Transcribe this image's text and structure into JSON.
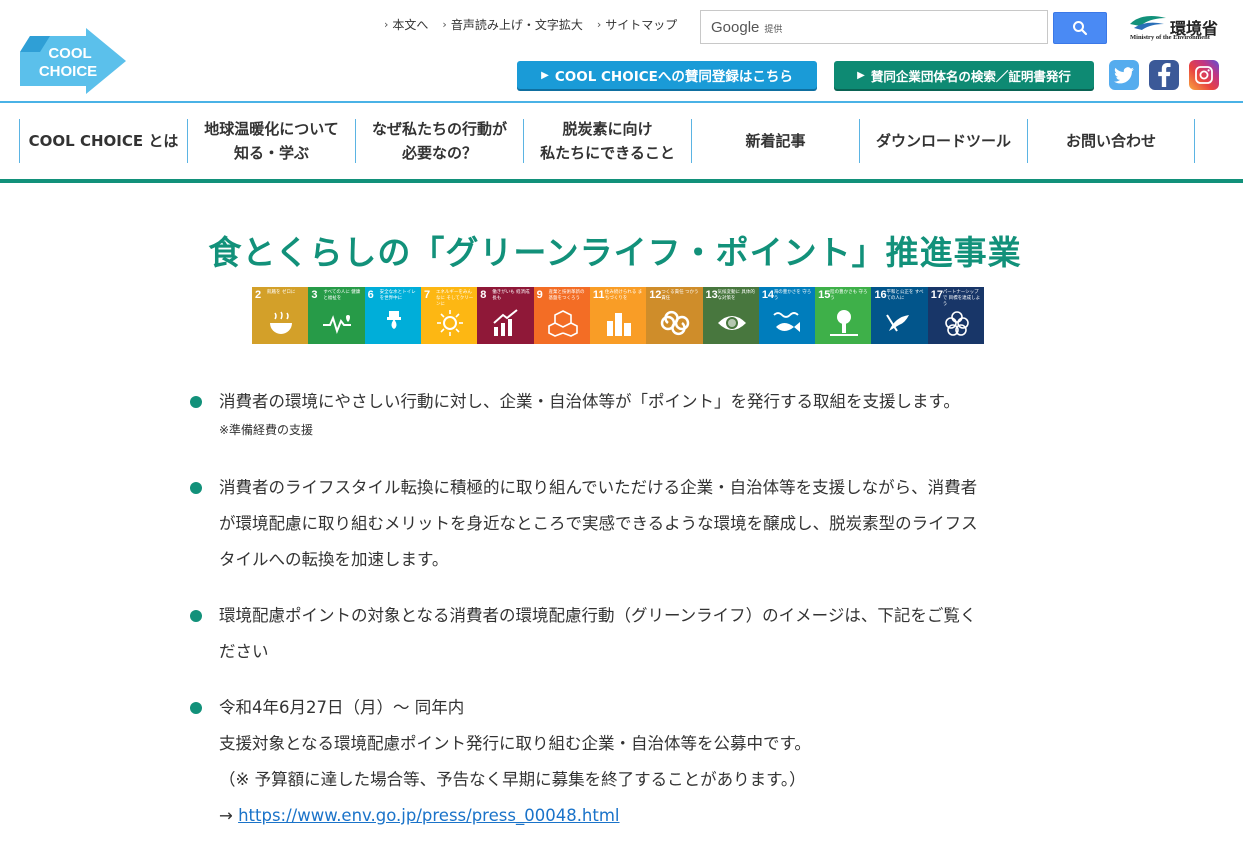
{
  "header": {
    "logo_line1": "COOL",
    "logo_line2": "CHOICE",
    "top_links": [
      "本文へ",
      "音声読み上げ・文字拡大",
      "サイトマップ"
    ],
    "search": {
      "brand": "Google",
      "brand_sub": "提供",
      "placeholder": ""
    },
    "ministry_name": "環境省",
    "ministry_sub": "Ministry of the Environment",
    "register_button": "COOL CHOICEへの賛同登録はこちら",
    "corp_search_button": "賛同企業団体名の検索／証明書発行",
    "sns": [
      "twitter-icon",
      "facebook-icon",
      "instagram-icon"
    ]
  },
  "nav": {
    "items": [
      "COOL CHOICE とは",
      "地球温暖化について\n知る・学ぶ",
      "なぜ私たちの行動が\n必要なの？",
      "脱炭素に向け\n私たちにできること",
      "新着記事",
      "ダウンロードツール",
      "お問い合わせ"
    ]
  },
  "main": {
    "title": "食とくらしの「グリーンライフ・ポイント」推進事業",
    "sdgs": [
      {
        "num": "2",
        "label": "飢餓を\nゼロに",
        "color": "#d3a029"
      },
      {
        "num": "3",
        "label": "すべての人に\n健康と福祉を",
        "color": "#279b48"
      },
      {
        "num": "6",
        "label": "安全な水とトイレ\nを世界中に",
        "color": "#00aed9"
      },
      {
        "num": "7",
        "label": "エネルギーをみんなに\nそしてクリーンに",
        "color": "#fdb713"
      },
      {
        "num": "8",
        "label": "働きがいも\n経済成長も",
        "color": "#8f1838"
      },
      {
        "num": "9",
        "label": "産業と技術革新の\n基盤をつくろう",
        "color": "#f36d25"
      },
      {
        "num": "11",
        "label": "住み続けられる\nまちづくりを",
        "color": "#f99d26"
      },
      {
        "num": "12",
        "label": "つくる責任\nつかう責任",
        "color": "#cf8d2a"
      },
      {
        "num": "13",
        "label": "気候変動に\n具体的な対策を",
        "color": "#48773e"
      },
      {
        "num": "14",
        "label": "海の豊かさを\n守ろう",
        "color": "#007dbc"
      },
      {
        "num": "15",
        "label": "陸の豊かさも\n守ろう",
        "color": "#3eb049"
      },
      {
        "num": "16",
        "label": "平和と公正を\nすべての人に",
        "color": "#02558b"
      },
      {
        "num": "17",
        "label": "パートナーシップで\n目標を達成しよう",
        "color": "#183668"
      }
    ],
    "bullet1": "消費者の環境にやさしい行動に対し、企業・自治体等が「ポイント」を発行する取組を支援します。",
    "bullet1_note": "※準備経費の支援",
    "bullet2_l1": "消費者のライフスタイル転換に積極的に取り組んでいただける企業・自治体等を支援しながら、消費者",
    "bullet2_l2": "が環境配慮に取り組むメリットを身近なところで実感できるような環境を醸成し、脱炭素型のライフス",
    "bullet2_l3": "タイルへの転換を加速します。",
    "bullet3_l1": "環境配慮ポイントの対象となる消費者の環境配慮行動（グリーンライフ）のイメージは、下記をご覧く",
    "bullet3_l2": "ださい",
    "bullet4_l1": "令和4年6月27日（月）〜 同年内",
    "bullet4_l2": "支援対象となる環境配慮ポイント発行に取り組む企業・自治体等を公募中です。",
    "bullet4_l3": "（※ 予算額に達した場合等、予告なく早期に募集を終了することがあります。）",
    "bullet4_arrow": "→",
    "bullet4_link": "https://www.env.go.jp/press/press_00048.html"
  }
}
